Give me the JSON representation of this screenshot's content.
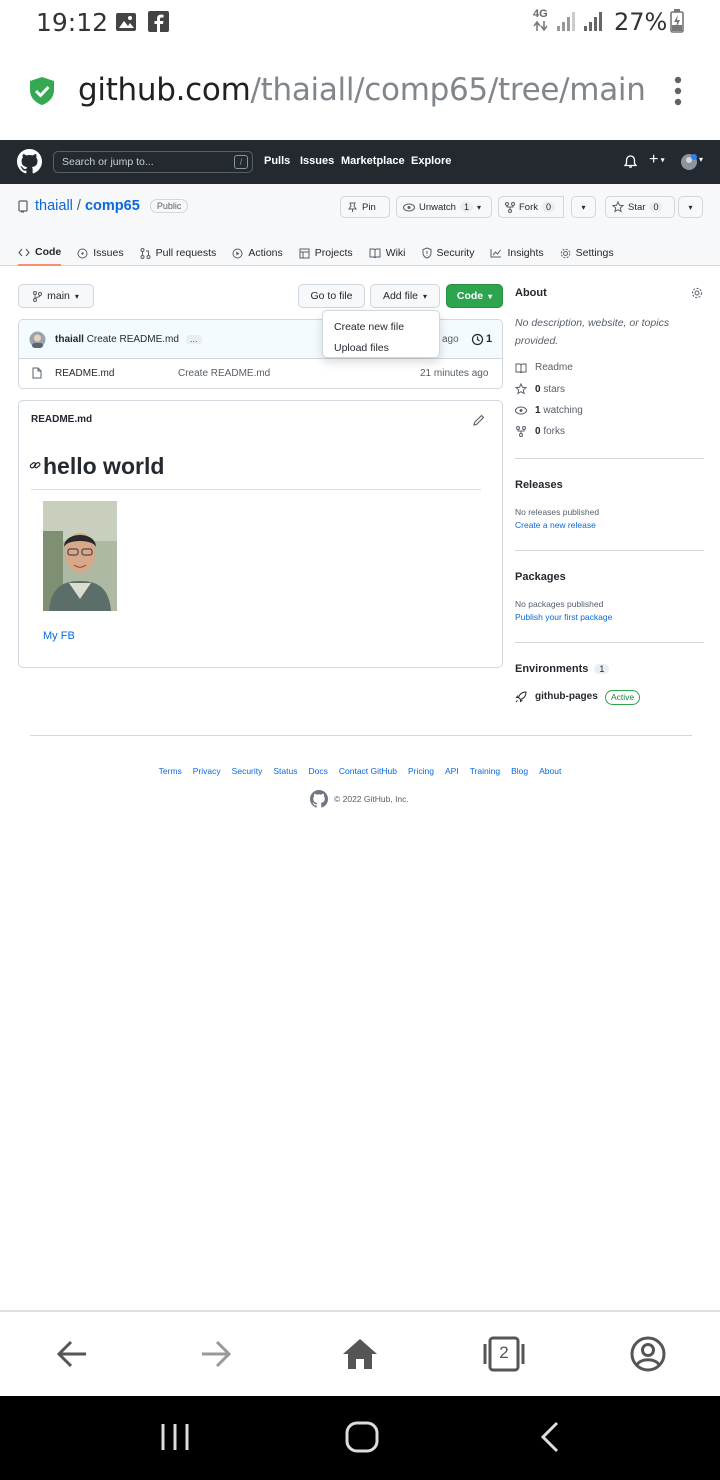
{
  "status_bar": {
    "time": "19:12",
    "network": "4G",
    "battery": "27%",
    "icons": [
      "image-icon",
      "facebook-icon",
      "signal-icon",
      "battery-charging-icon"
    ]
  },
  "browser": {
    "url_host": "github.com",
    "url_path": "/thaiall/comp65/tree/main",
    "secure_icon": "shield-check-icon",
    "tabs_count": "2"
  },
  "github_header": {
    "search_placeholder": "Search or jump to...",
    "search_key": "/",
    "nav": [
      "Pulls",
      "Issues",
      "Marketplace",
      "Explore"
    ],
    "plus": "+"
  },
  "repo": {
    "owner": "thaiall",
    "separator": "/",
    "name": "comp65",
    "visibility": "Public",
    "pin_label": "Pin",
    "unwatch_label": "Unwatch",
    "unwatch_count": "1",
    "fork_label": "Fork",
    "fork_count": "0",
    "star_label": "Star",
    "star_count": "0",
    "tabs": [
      {
        "label": "Code",
        "icon": "code-icon"
      },
      {
        "label": "Issues",
        "icon": "issue-icon"
      },
      {
        "label": "Pull requests",
        "icon": "pull-request-icon"
      },
      {
        "label": "Actions",
        "icon": "play-icon"
      },
      {
        "label": "Projects",
        "icon": "table-icon"
      },
      {
        "label": "Wiki",
        "icon": "book-icon"
      },
      {
        "label": "Security",
        "icon": "shield-icon"
      },
      {
        "label": "Insights",
        "icon": "graph-icon"
      },
      {
        "label": "Settings",
        "icon": "gear-icon"
      }
    ]
  },
  "toolbar": {
    "branch": "main",
    "go_to_file": "Go to file",
    "add_file": "Add file",
    "code": "Code",
    "add_file_menu": [
      "Create new file",
      "Upload files"
    ]
  },
  "commit": {
    "author": "thaiall",
    "message": "Create README.md",
    "ellipsis": "…",
    "time_partial": "ago",
    "commits_count": "1"
  },
  "files": [
    {
      "name": "README.md",
      "message": "Create README.md",
      "time": "21 minutes ago"
    }
  ],
  "readme": {
    "filename": "README.md",
    "heading": "hello world",
    "link": "My FB"
  },
  "about": {
    "title": "About",
    "description": "No description, website, or topics provided.",
    "readme": "Readme",
    "stars_count": "0",
    "stars_label": "stars",
    "watching_count": "1",
    "watching_label": "watching",
    "forks_count": "0",
    "forks_label": "forks"
  },
  "releases": {
    "title": "Releases",
    "empty": "No releases published",
    "link": "Create a new release"
  },
  "packages": {
    "title": "Packages",
    "empty": "No packages published",
    "link": "Publish your first package"
  },
  "environments": {
    "title": "Environments",
    "count": "1",
    "item": "github-pages",
    "status": "Active"
  },
  "footer": {
    "links": [
      "Terms",
      "Privacy",
      "Security",
      "Status",
      "Docs",
      "Contact GitHub",
      "Pricing",
      "API",
      "Training",
      "Blog",
      "About"
    ],
    "copyright": "© 2022 GitHub, Inc."
  },
  "colors": {
    "header_bg": "#24292f",
    "link": "#0969da",
    "green": "#2da44e",
    "active_tab": "#fd8c73"
  }
}
